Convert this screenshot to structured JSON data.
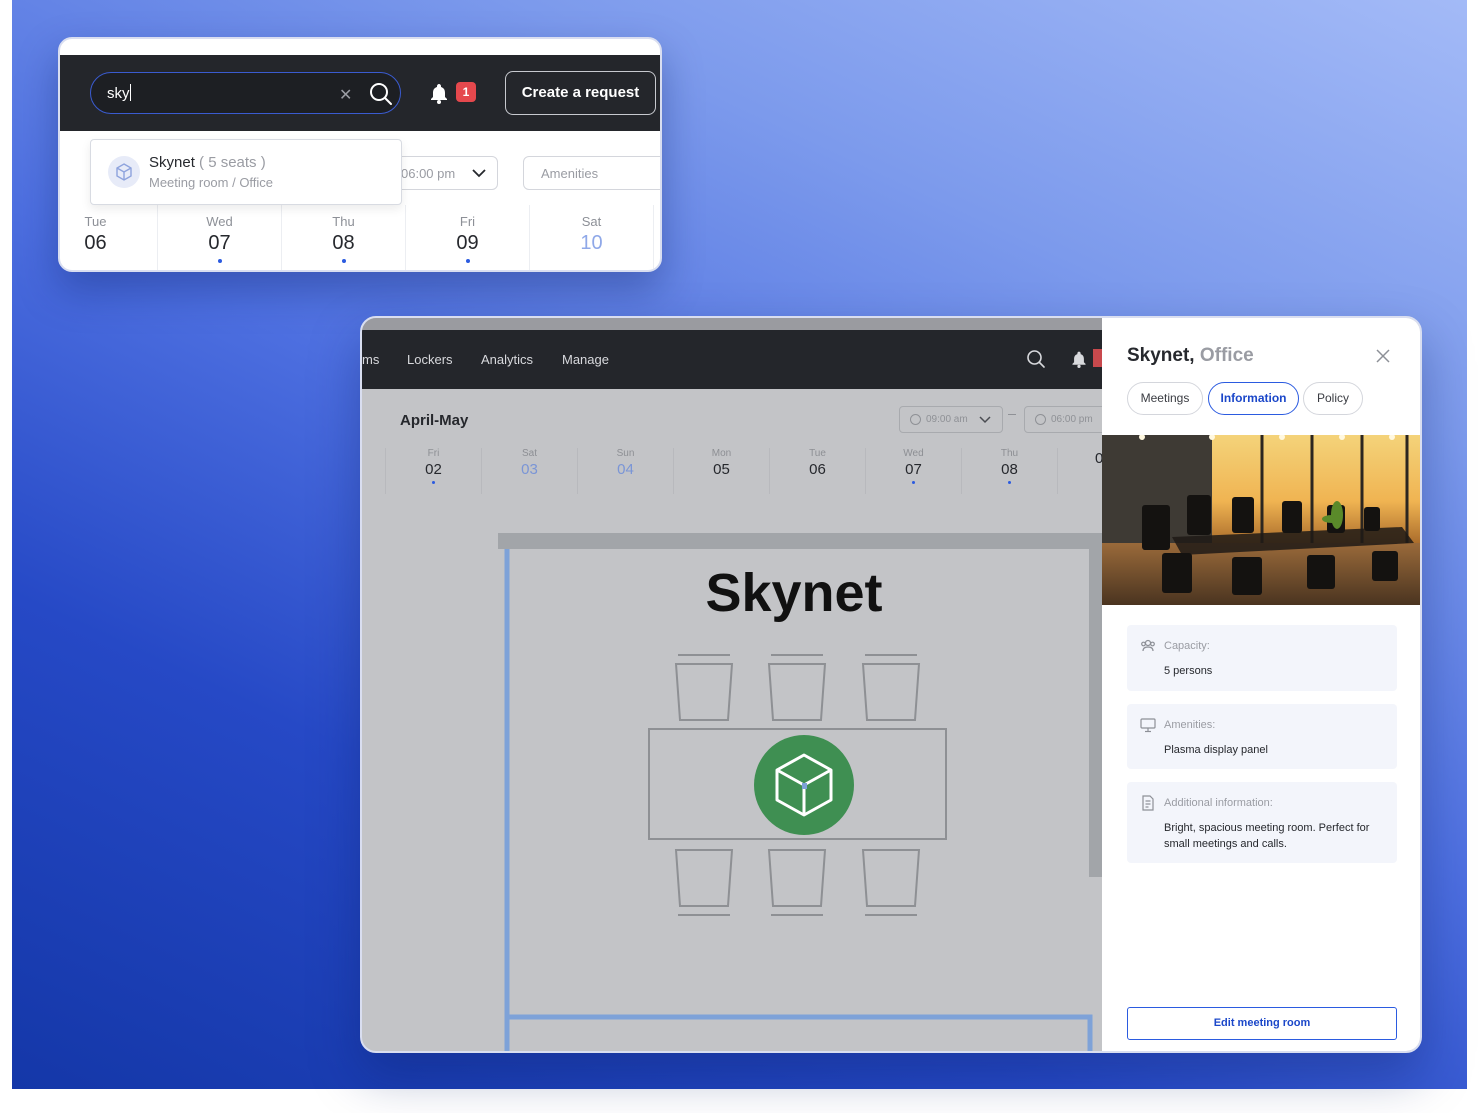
{
  "search_card": {
    "search": {
      "value": "sky"
    },
    "notification_count": "1",
    "create_request_label": "Create a request",
    "time_select": "06:00 pm",
    "amenities_placeholder": "Amenities",
    "suggestion": {
      "name": "Skynet",
      "seats": "( 5 seats )",
      "subtitle": "Meeting room / Office"
    },
    "days": [
      {
        "name": "Tue",
        "date": "06",
        "dot": false,
        "weekend": false
      },
      {
        "name": "Wed",
        "date": "07",
        "dot": true,
        "weekend": false
      },
      {
        "name": "Thu",
        "date": "08",
        "dot": true,
        "weekend": false
      },
      {
        "name": "Fri",
        "date": "09",
        "dot": true,
        "weekend": false
      },
      {
        "name": "Sat",
        "date": "10",
        "dot": false,
        "weekend": true
      }
    ]
  },
  "main_card": {
    "nav": {
      "items": [
        "ms",
        "Lockers",
        "Analytics",
        "Manage"
      ]
    },
    "calendar": {
      "month_label": "April-May",
      "start_time": "09:00 am",
      "end_time": "06:00 pm",
      "days": [
        {
          "name": "Fri",
          "date": "02",
          "dot": true,
          "weekend": false
        },
        {
          "name": "Sat",
          "date": "03",
          "dot": false,
          "weekend": true
        },
        {
          "name": "Sun",
          "date": "04",
          "dot": false,
          "weekend": true
        },
        {
          "name": "Mon",
          "date": "05",
          "dot": false,
          "weekend": false
        },
        {
          "name": "Tue",
          "date": "06",
          "dot": false,
          "weekend": false
        },
        {
          "name": "Wed",
          "date": "07",
          "dot": true,
          "weekend": false
        },
        {
          "name": "Thu",
          "date": "08",
          "dot": true,
          "weekend": false
        },
        {
          "name": "",
          "date": "0",
          "dot": false,
          "weekend": false
        }
      ]
    },
    "floor_plan": {
      "room_label": "Skynet",
      "status_color": "#3f8f52"
    },
    "panel": {
      "title": "Skynet,",
      "subtitle": "Office",
      "tabs": [
        "Meetings",
        "Information",
        "Policy"
      ],
      "active_tab": "Information",
      "capacity_label": "Capacity:",
      "capacity_value": "5 persons",
      "amenities_label": "Amenities:",
      "amenities_value": "Plasma display panel",
      "additional_label": "Additional information:",
      "additional_value": "Bright, spacious meeting room. Perfect for small meetings and calls.",
      "edit_label": "Edit meeting room"
    }
  },
  "colors": {
    "accent": "#2b5be0",
    "topbar": "#24262b",
    "badge": "#e5484d"
  }
}
